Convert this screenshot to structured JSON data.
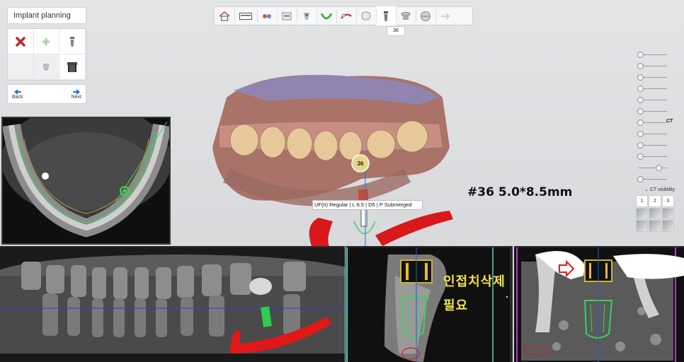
{
  "panel": {
    "title": "Implant planning",
    "back_label": "Back",
    "next_label": "Next"
  },
  "toolbar": {
    "tooth_tip": "36"
  },
  "right_panel": {
    "ct_label": "CT",
    "ct_visibility": "CT visibility",
    "view_tabs": [
      "1",
      "2",
      "3"
    ]
  },
  "model": {
    "tooth_number": "36",
    "implant_info": "UF(II) Regular | L 8.5 | D5 | P Submerged",
    "spec_annotation": "#36 5.0*8.5mm"
  },
  "cross_section": {
    "note_line1": "인접치삭제",
    "note_line2": "필요"
  },
  "colors": {
    "nerve_red": "#d8181a",
    "implant_green": "#3ad35a",
    "crown_yellow": "#f0c020",
    "korean_text": "#f3e14a"
  }
}
